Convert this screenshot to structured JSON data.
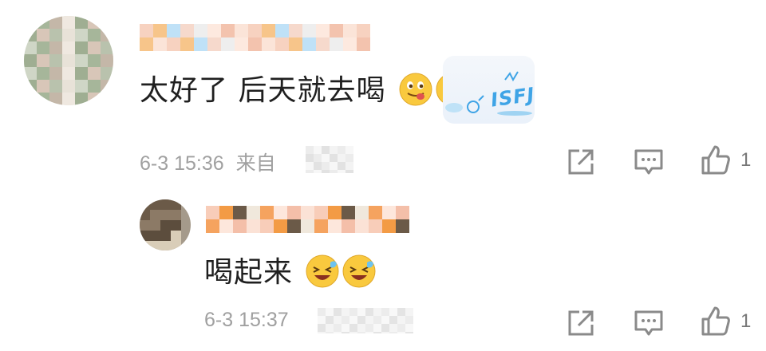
{
  "comments": [
    {
      "text": "太好了 后天就去喝",
      "emojis": [
        "tongue-face-emoji",
        "tongue-face-emoji"
      ],
      "badge_text": "ISFJ",
      "time": "6-3 15:36",
      "source_prefix": "来自",
      "like_count": "1"
    },
    {
      "text": "喝起来",
      "emojis": [
        "laughing-tears-emoji",
        "laughing-tears-emoji"
      ],
      "time": "6-3 15:37",
      "like_count": "1"
    }
  ],
  "colors": {
    "text_primary": "#1f1f1f",
    "text_meta": "#a0a0a0",
    "icon_gray": "#8a8a8a",
    "badge_blue": "#3fa4e6",
    "emoji_yellow": "#f9c93e"
  }
}
